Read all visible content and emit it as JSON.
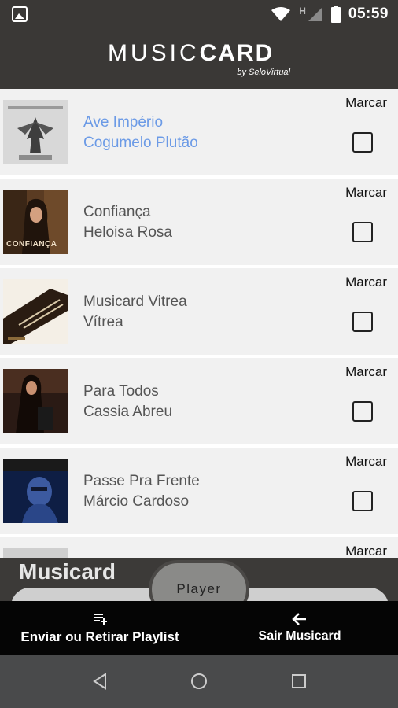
{
  "status": {
    "time": "05:59",
    "network": "H"
  },
  "header": {
    "logo_main": "MUSIC",
    "logo_bold": "CARD",
    "logo_sub": "by SeloVirtual"
  },
  "tracks": [
    {
      "title": "Ave Império",
      "artist": "Cogumelo Plutão",
      "mark": "Marcar",
      "active": true
    },
    {
      "title": "Confiança",
      "artist": "Heloisa Rosa",
      "mark": "Marcar",
      "cover_text": "CONFIANÇA"
    },
    {
      "title": "Musicard Vitrea",
      "artist": "Vítrea",
      "mark": "Marcar"
    },
    {
      "title": "Para Todos",
      "artist": "Cassia Abreu",
      "mark": "Marcar"
    },
    {
      "title": "Passe Pra Frente",
      "artist": "Márcio Cardoso",
      "mark": "Marcar"
    },
    {
      "title": "",
      "artist": "",
      "mark": "Marcar"
    }
  ],
  "player": {
    "title": "Musicard",
    "button": "Player"
  },
  "bottom_nav": {
    "left_label": "Enviar ou Retirar Playlist",
    "right_label": "Sair Musicard"
  },
  "colors": {
    "header_bg": "#3a3836",
    "row_bg": "#f1f1f1",
    "active_text": "#6b9ae6",
    "nav_bg": "#050505",
    "system_nav_bg": "#494a4b"
  }
}
